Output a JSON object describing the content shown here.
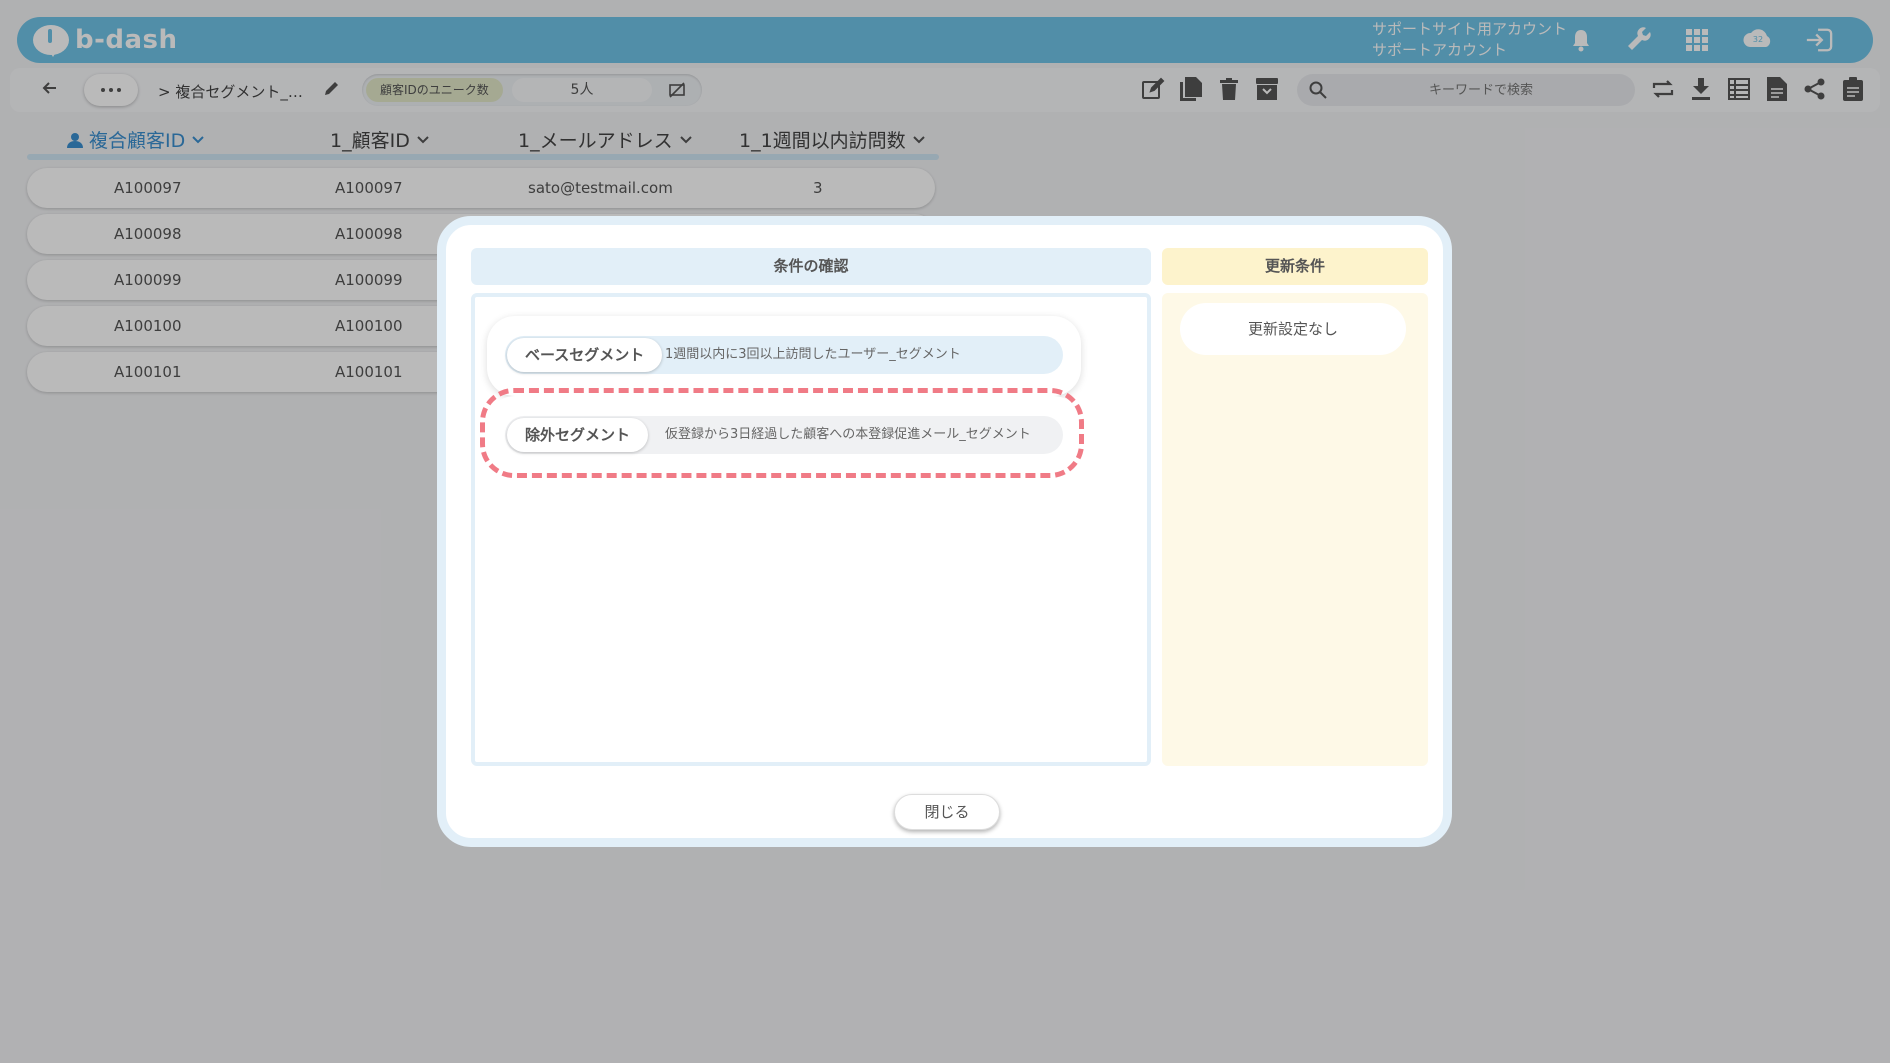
{
  "header": {
    "logo_text": "b-dash",
    "account_line1": "サポートサイト用アカウント",
    "account_line2": "サポートアカウント",
    "cloud_badge": "32"
  },
  "toolbar": {
    "breadcrumb": "> 複合セグメント_…",
    "metric_label": "顧客IDのユニーク数",
    "metric_value": "5人",
    "search_placeholder": "キーワードで検索"
  },
  "table": {
    "columns": [
      "複合顧客ID",
      "1_顧客ID",
      "1_メールアドレス",
      "1_1週間以内訪問数"
    ],
    "rows": [
      [
        "A100097",
        "A100097",
        "sato@testmail.com",
        "3"
      ],
      [
        "A100098",
        "A100098",
        "",
        ""
      ],
      [
        "A100099",
        "A100099",
        "",
        ""
      ],
      [
        "A100100",
        "A100100",
        "",
        ""
      ],
      [
        "A100101",
        "A100101",
        "",
        ""
      ]
    ]
  },
  "modal": {
    "left_title": "条件の確認",
    "right_title": "更新条件",
    "base_segment_label": "ベースセグメント",
    "base_segment_value": "1週間以内に3回以上訪問したユーザー_セグメント",
    "exclude_segment_label": "除外セグメント",
    "exclude_segment_value": "仮登録から3日経過した顧客への本登録促進メール_セグメント",
    "update_setting": "更新設定なし",
    "close_label": "閉じる"
  },
  "colors": {
    "brand": "#6fc3e6",
    "highlight_dash": "#f07b86",
    "panel_blue": "#e2eff8",
    "panel_yellow": "#fef9e7"
  }
}
